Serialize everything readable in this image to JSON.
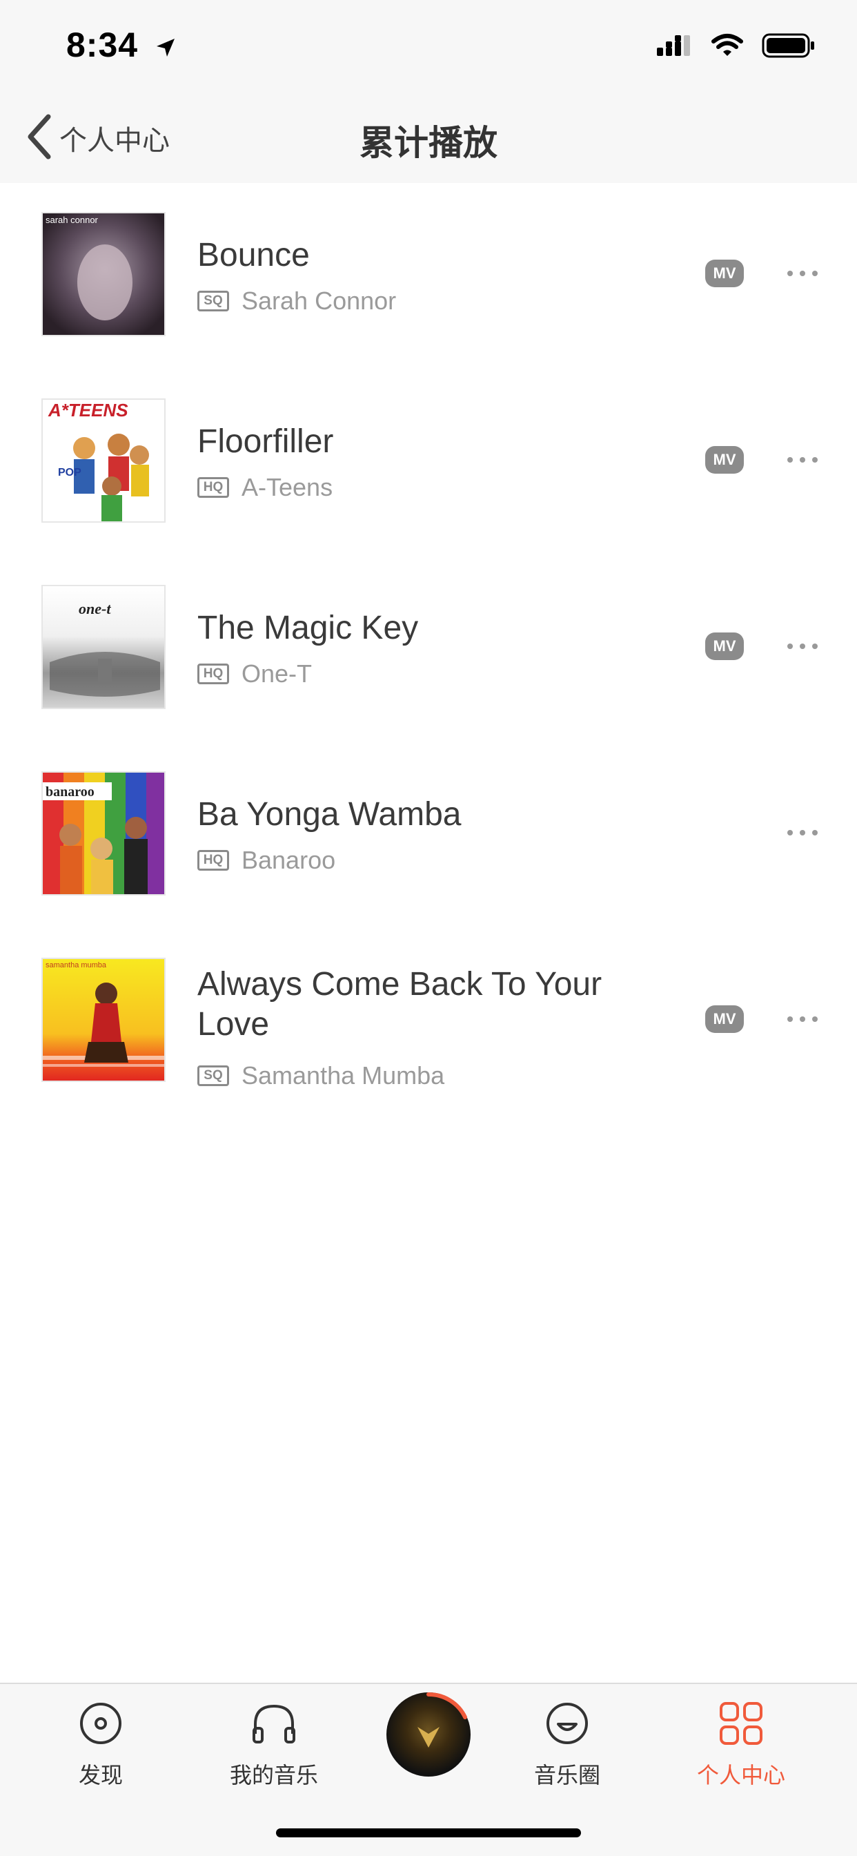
{
  "status_bar": {
    "time": "8:34"
  },
  "nav": {
    "back_label": "个人中心",
    "title": "累计播放"
  },
  "songs": [
    {
      "title": "Bounce",
      "quality": "SQ",
      "artist": "Sarah Connor",
      "has_mv": true,
      "cover_text": "sarah connor"
    },
    {
      "title": "Floorfiller",
      "quality": "HQ",
      "artist": "A-Teens",
      "has_mv": true,
      "cover_text": "A*TEENS"
    },
    {
      "title": "The Magic Key",
      "quality": "HQ",
      "artist": "One-T",
      "has_mv": true,
      "cover_text": "one-t"
    },
    {
      "title": "Ba Yonga Wamba",
      "quality": "HQ",
      "artist": "Banaroo",
      "has_mv": false,
      "cover_text": "banaroo"
    },
    {
      "title": "Always Come Back To Your Love",
      "quality": "SQ",
      "artist": "Samantha Mumba",
      "has_mv": true,
      "cover_text": "samantha mumba"
    }
  ],
  "mv_label": "MV",
  "tabs": [
    {
      "label": "发现",
      "icon": "disc-icon",
      "active": false
    },
    {
      "label": "我的音乐",
      "icon": "headphones-icon",
      "active": false
    },
    {
      "label": "音乐圈",
      "icon": "smile-icon",
      "active": false
    },
    {
      "label": "个人中心",
      "icon": "grid-icon",
      "active": true
    }
  ],
  "colors": {
    "accent": "#f05a3b",
    "badge": "#8b8b8b",
    "background": "#ffffff",
    "bar_background": "#f7f7f7"
  }
}
